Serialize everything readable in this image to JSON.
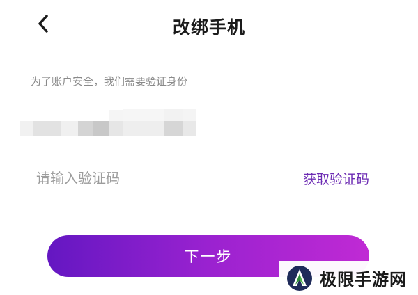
{
  "header": {
    "back_icon": "chevron-left-icon",
    "title": "改绑手机"
  },
  "form": {
    "hint": "为了账户安全，我们需要验证身份",
    "phone_number_masked": "",
    "code_placeholder": "请输入验证码",
    "code_value": "",
    "get_code_label": "获取验证码"
  },
  "actions": {
    "next_label": "下一步"
  },
  "watermark": {
    "logo_icon": "site-logo-icon",
    "text": "极限手游网"
  },
  "colors": {
    "accent": "#6c2bb3",
    "button_gradient_start": "#6417c2",
    "button_gradient_end": "#c02ad4",
    "hint_text": "#8a8a8a",
    "placeholder_text": "#9c9c9c",
    "logo_green": "#2f8f3a",
    "logo_navy": "#1f2a5a"
  }
}
